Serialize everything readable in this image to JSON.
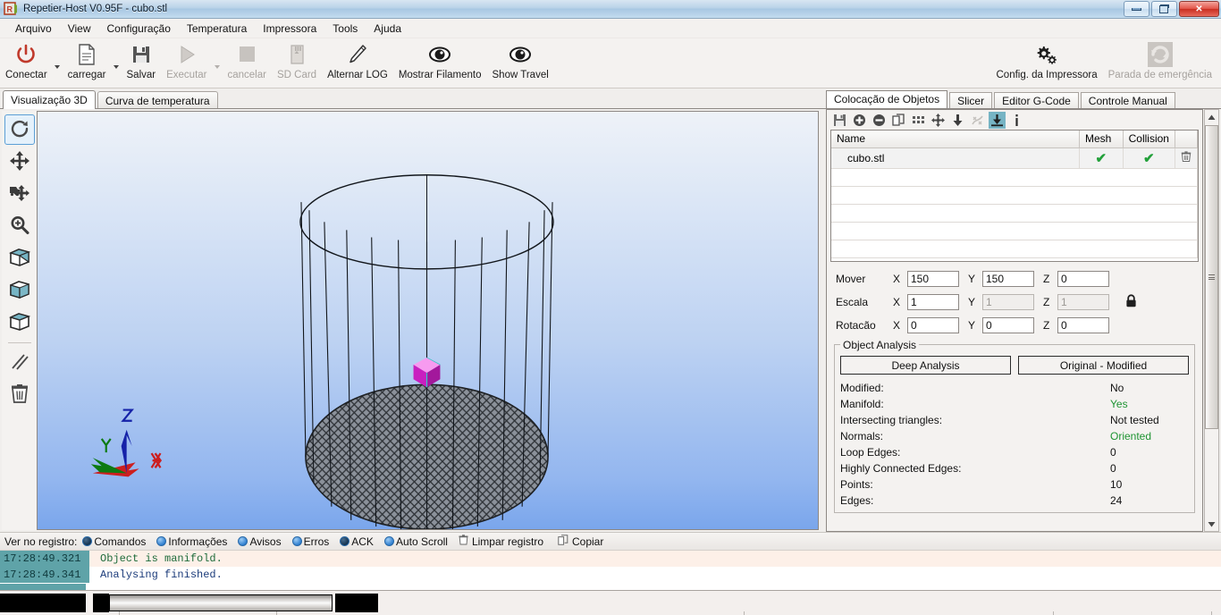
{
  "window": {
    "title": "Repetier-Host V0.95F - cubo.stl",
    "app_icon": "repetier-logo-icon",
    "buttons": {
      "minimize": "minimize-icon",
      "restore": "restore-icon",
      "close": "close-icon"
    }
  },
  "menu": {
    "items": [
      {
        "label": "Arquivo"
      },
      {
        "label": "View"
      },
      {
        "label": "Configuração"
      },
      {
        "label": "Temperatura"
      },
      {
        "label": "Impressora"
      },
      {
        "label": "Tools"
      },
      {
        "label": "Ajuda"
      }
    ]
  },
  "toolbar": {
    "left_buttons": [
      {
        "label": "Conectar",
        "icon": "power-icon",
        "enabled": true,
        "dropdown": true
      },
      {
        "label": "carregar",
        "icon": "document-icon",
        "enabled": true,
        "dropdown": true
      },
      {
        "label": "Salvar",
        "icon": "floppy-disk-icon",
        "enabled": true,
        "dropdown": false
      },
      {
        "label": "Executar",
        "icon": "play-icon",
        "enabled": false,
        "dropdown": true
      },
      {
        "label": "cancelar",
        "icon": "stop-icon",
        "enabled": false,
        "dropdown": false
      },
      {
        "label": "SD Card",
        "icon": "sd-card-icon",
        "enabled": false,
        "dropdown": false
      },
      {
        "label": "Alternar LOG",
        "icon": "pencil-icon",
        "enabled": true,
        "dropdown": false
      },
      {
        "label": "Mostrar Filamento",
        "icon": "eye-icon",
        "enabled": true,
        "dropdown": false
      },
      {
        "label": "Show Travel",
        "icon": "eye-icon",
        "enabled": true,
        "dropdown": false
      }
    ],
    "right_buttons": [
      {
        "label": "Config. da Impressora",
        "icon": "gears-icon",
        "enabled": true
      },
      {
        "label": "Parada de emergência",
        "icon": "emergency-stop-icon",
        "enabled": false
      }
    ]
  },
  "left_panel": {
    "tabs": [
      {
        "label": "Visualização 3D",
        "active": true
      },
      {
        "label": "Curva de temperatura",
        "active": false
      }
    ],
    "view_tools": [
      {
        "name": "rotate-view-tool",
        "icon": "rotate-icon",
        "active": true
      },
      {
        "name": "move-view-tool",
        "icon": "move-arrows-icon",
        "active": false
      },
      {
        "name": "move-object-tool",
        "icon": "move-object-icon",
        "active": false
      },
      {
        "name": "zoom-tool",
        "icon": "magnifier-plus-icon",
        "active": false
      },
      {
        "name": "view-mode-1-tool",
        "icon": "cube-shaded-icon",
        "active": false
      },
      {
        "name": "view-mode-2-tool",
        "icon": "cube-solid-icon",
        "active": false
      },
      {
        "name": "view-mode-3-tool",
        "icon": "cube-wire-icon",
        "active": false
      },
      {
        "name": "parallel-view-tool",
        "icon": "parallel-lines-icon",
        "active": false
      },
      {
        "name": "delete-object-tool",
        "icon": "trash-icon",
        "active": false
      }
    ],
    "axis_labels": {
      "x": "X",
      "y": "Y",
      "z": "Z"
    }
  },
  "right_panel": {
    "tabs": [
      {
        "label": "Colocação de Objetos",
        "active": true
      },
      {
        "label": "Slicer",
        "active": false
      },
      {
        "label": "Editor G-Code",
        "active": false
      },
      {
        "label": "Controle Manual",
        "active": false
      }
    ],
    "tools": [
      {
        "name": "save-objects-icon",
        "selected": false
      },
      {
        "name": "add-object-icon",
        "selected": false
      },
      {
        "name": "remove-object-icon",
        "selected": false
      },
      {
        "name": "copy-object-icon",
        "selected": false
      },
      {
        "name": "multiply-object-icon",
        "selected": false
      },
      {
        "name": "center-object-icon",
        "selected": false
      },
      {
        "name": "drop-object-icon",
        "selected": false
      },
      {
        "name": "autoposition-icon",
        "selected": false
      },
      {
        "name": "place-on-platform-icon",
        "selected": true
      },
      {
        "name": "info-icon",
        "selected": false
      }
    ],
    "table": {
      "headers": [
        "Name",
        "Mesh",
        "Collision",
        ""
      ],
      "rows": [
        {
          "name": "cubo.stl",
          "mesh": "✔",
          "collision": "✔",
          "delete": "trash-icon"
        }
      ]
    },
    "transform": {
      "rows": [
        {
          "label": "Mover",
          "x": "150",
          "y": "150",
          "z": "0",
          "disabled": [
            false,
            false,
            false
          ]
        },
        {
          "label": "Escala",
          "x": "1",
          "y": "1",
          "z": "1",
          "disabled": [
            false,
            true,
            true
          ]
        },
        {
          "label": "Rotacão",
          "x": "0",
          "y": "0",
          "z": "0",
          "disabled": [
            false,
            false,
            false
          ]
        }
      ],
      "axis": {
        "x": "X",
        "y": "Y",
        "z": "Z"
      },
      "lock_icon": "lock-closed-icon"
    },
    "analysis": {
      "title": "Object Analysis",
      "buttons": [
        {
          "label": "Deep Analysis"
        },
        {
          "label": "Original - Modified"
        }
      ],
      "stats": [
        {
          "key": "Modified:",
          "value": "No",
          "good": false
        },
        {
          "key": "Manifold:",
          "value": "Yes",
          "good": true
        },
        {
          "key": "Intersecting triangles:",
          "value": "Not tested",
          "good": false
        },
        {
          "key": "Normals:",
          "value": "Oriented",
          "good": true
        },
        {
          "key": "Loop Edges:",
          "value": "0",
          "good": false
        },
        {
          "key": "Highly Connected Edges:",
          "value": "0",
          "good": false
        },
        {
          "key": "Points:",
          "value": "10",
          "good": false
        },
        {
          "key": "Edges:",
          "value": "24",
          "good": false
        }
      ]
    },
    "scrollbar": {
      "up": "scroll-up-icon",
      "down": "scroll-down-icon"
    }
  },
  "log_panel": {
    "label": "Ver no registro:",
    "filters": [
      {
        "label": "Comandos",
        "checked": true
      },
      {
        "label": "Informações",
        "checked": false
      },
      {
        "label": "Avisos",
        "checked": false
      },
      {
        "label": "Erros",
        "checked": false
      },
      {
        "label": "ACK",
        "checked": true
      },
      {
        "label": "Auto Scroll",
        "checked": false
      }
    ],
    "actions": [
      {
        "label": "Limpar registro",
        "icon": "trash-icon"
      },
      {
        "label": "Copiar",
        "icon": "copy-icon"
      }
    ],
    "entries": [
      {
        "time": "17:28:49.321",
        "message": "Object is manifold.",
        "kind": "info"
      },
      {
        "time": "17:28:49.341",
        "message": "Analysing finished.",
        "kind": "normal"
      }
    ]
  },
  "colors": {
    "accent_blue": "#2f7fd0",
    "success_green": "#1e9432",
    "teal": "#5fa3a8",
    "viewport_top": "#eef2f8",
    "viewport_bottom": "#7aa6ec",
    "selection_magenta": "#d63ad6"
  }
}
